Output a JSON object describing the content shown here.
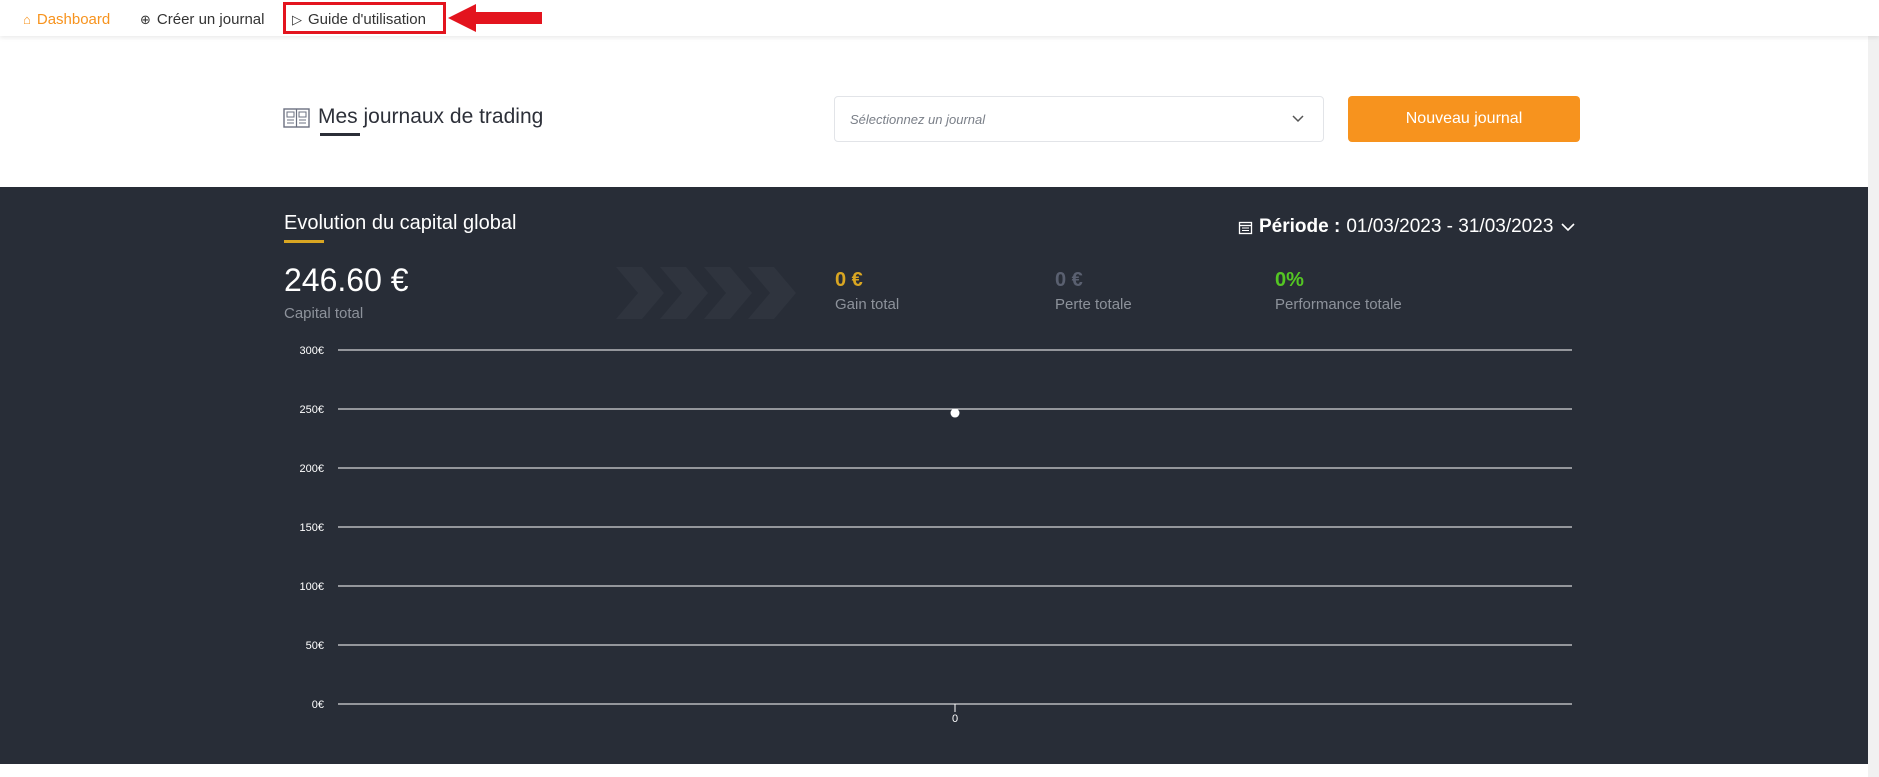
{
  "nav": {
    "dashboard": "Dashboard",
    "create": "Créer un journal",
    "guide": "Guide d'utilisation"
  },
  "header": {
    "title": "Mes journaux de trading",
    "select_placeholder": "Sélectionnez un journal",
    "new_button": "Nouveau journal"
  },
  "section": {
    "title": "Evolution du capital global",
    "period_label": "Période :",
    "period_value": "01/03/2023 - 31/03/2023"
  },
  "stats": {
    "capital_value": "246.60 €",
    "capital_label": "Capital total",
    "gain_value": "0 €",
    "gain_label": "Gain total",
    "loss_value": "0 €",
    "loss_label": "Perte totale",
    "perf_value": "0%",
    "perf_label": "Performance totale"
  },
  "colors": {
    "accent": "#f7931e",
    "dark_bg": "#282d37",
    "gain": "#d9a622",
    "loss": "#5a6070",
    "perf": "#54c623",
    "annotation": "#e3141e"
  },
  "chart_data": {
    "type": "line",
    "x": [
      "0"
    ],
    "series": [
      {
        "values": [
          246.6
        ]
      }
    ],
    "yticks": [
      "0€",
      "50€",
      "100€",
      "150€",
      "200€",
      "250€",
      "300€"
    ],
    "ylim": [
      0,
      300
    ],
    "grid": true
  }
}
